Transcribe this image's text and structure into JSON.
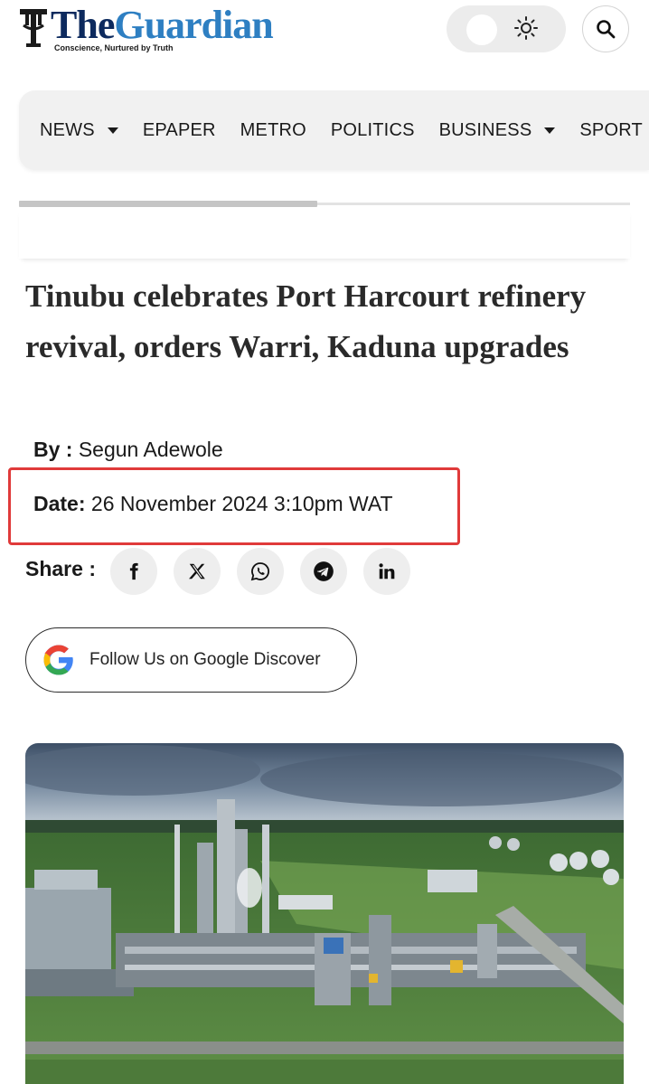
{
  "header": {
    "logo_words": [
      "The",
      "Guardian"
    ],
    "tagline": "Conscience, Nurtured by Truth",
    "theme_toggle_icon": "sun-icon",
    "search_icon": "search-icon"
  },
  "nav": {
    "items": [
      {
        "label": "NEWS",
        "has_dropdown": true
      },
      {
        "label": "EPAPER",
        "has_dropdown": false
      },
      {
        "label": "METRO",
        "has_dropdown": false
      },
      {
        "label": "POLITICS",
        "has_dropdown": false
      },
      {
        "label": "BUSINESS",
        "has_dropdown": true
      },
      {
        "label": "SPORT",
        "has_dropdown": false
      }
    ],
    "scroll_progress": 0.49
  },
  "article": {
    "headline": "Tinubu celebrates Port Harcourt refinery revival, orders Warri, Kaduna upgrades",
    "by_label": "By :",
    "author": "Segun Adewole",
    "date_label": "Date:",
    "date_value": "26 November 2024 3:10pm WAT",
    "share_label": "Share :",
    "share_icons": [
      "facebook-icon",
      "x-icon",
      "whatsapp-icon",
      "telegram-icon",
      "linkedin-icon"
    ],
    "share_glyphs": [
      "f",
      "𝕏",
      "",
      "",
      "in"
    ],
    "discover_label": "Follow Us on Google Discover"
  },
  "colors": {
    "brand_dark": "#0d2a5e",
    "brand_blue": "#2e7fc2",
    "highlight_box": "#e03a3a",
    "nav_bg": "#f1f1f1"
  }
}
